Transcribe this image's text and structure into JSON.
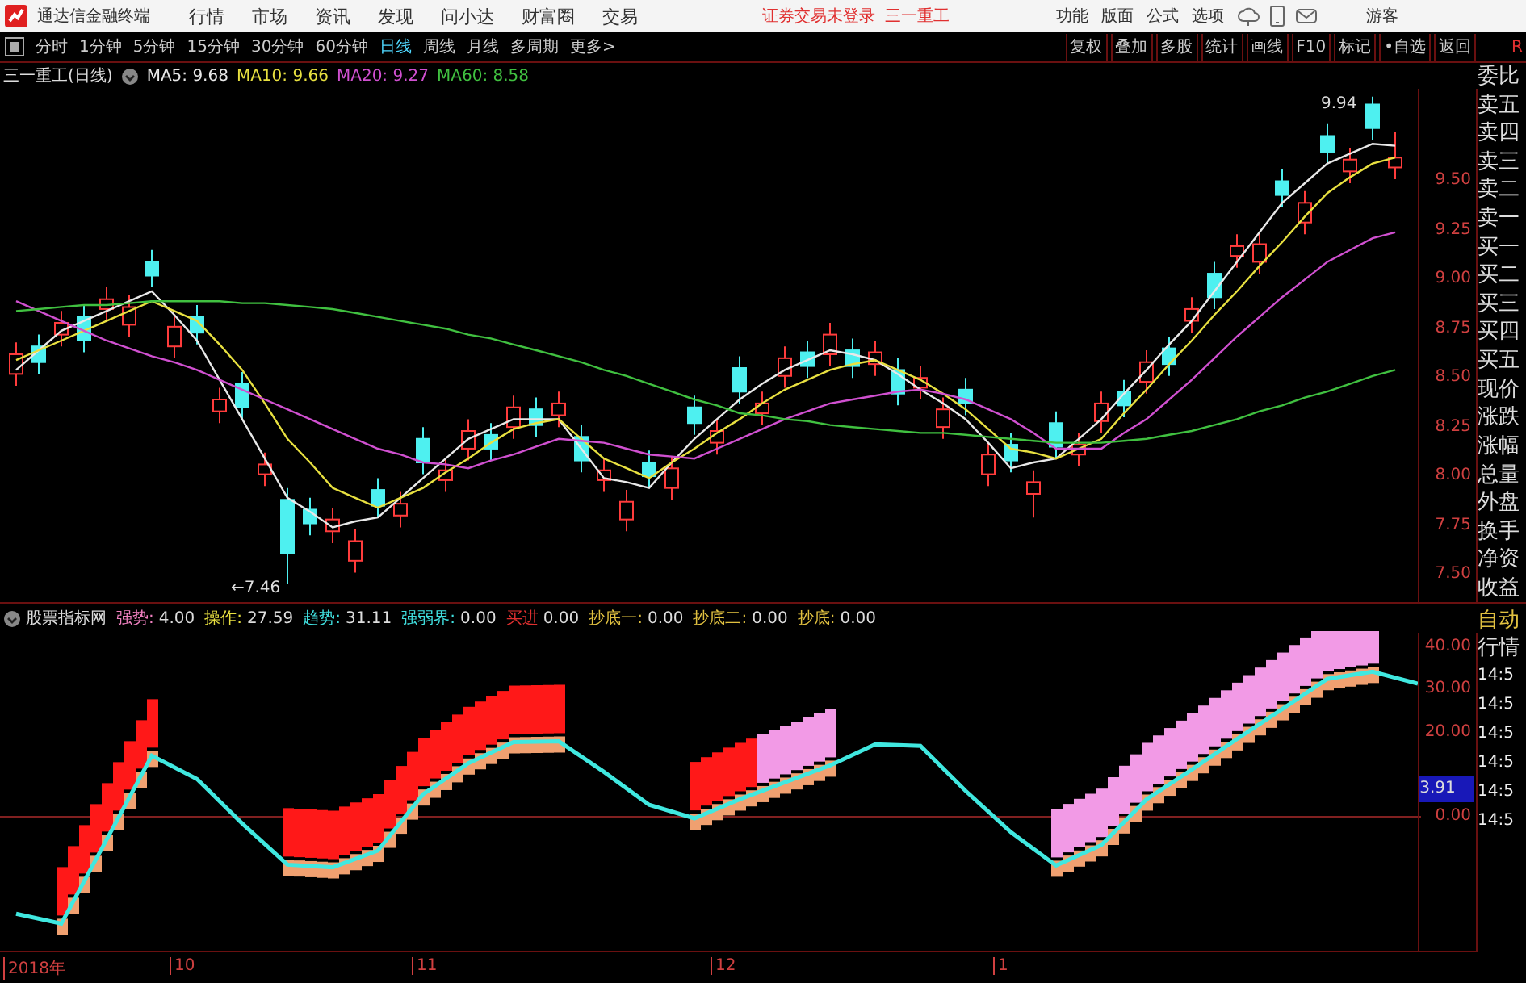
{
  "menu_bar": {
    "app_title": "通达信金融终端",
    "items": [
      "行情",
      "市场",
      "资讯",
      "发现",
      "问小达",
      "财富圈",
      "交易"
    ],
    "status": "证券交易未登录",
    "stock": "三一重工",
    "right_items": [
      "功能",
      "版面",
      "公式",
      "选项"
    ],
    "user": "游客"
  },
  "period_tabs": [
    {
      "label": "分时",
      "selected": false
    },
    {
      "label": "1分钟",
      "selected": false
    },
    {
      "label": "5分钟",
      "selected": false
    },
    {
      "label": "15分钟",
      "selected": false
    },
    {
      "label": "30分钟",
      "selected": false
    },
    {
      "label": "60分钟",
      "selected": false
    },
    {
      "label": "日线",
      "selected": true
    },
    {
      "label": "周线",
      "selected": false
    },
    {
      "label": "月线",
      "selected": false
    },
    {
      "label": "多周期",
      "selected": false
    },
    {
      "label": "更多>",
      "selected": false
    }
  ],
  "tool_buttons": [
    "复权",
    "叠加",
    "多股",
    "统计",
    "画线",
    "F10",
    "标记",
    "•自选",
    "返回"
  ],
  "corner_label": "R",
  "price_chart": {
    "title": "三一重工(日线)",
    "ma": [
      {
        "label": "MA5: 9.68",
        "color": "#e8e8e8"
      },
      {
        "label": "MA10: 9.66",
        "color": "#e8e040"
      },
      {
        "label": "MA20: 9.27",
        "color": "#d050d0"
      },
      {
        "label": "MA60: 8.58",
        "color": "#40c040"
      }
    ],
    "high_label": "9.94",
    "low_label": "←7.46",
    "chart_data": {
      "type": "candlestick",
      "ylim": [
        7.37,
        9.98
      ],
      "yticks": [
        {
          "value": 9.5,
          "label": "9.50"
        },
        {
          "value": 9.25,
          "label": "9.25"
        },
        {
          "value": 9.0,
          "label": "9.00"
        },
        {
          "value": 8.75,
          "label": "8.75"
        },
        {
          "value": 8.5,
          "label": "8.50"
        },
        {
          "value": 8.25,
          "label": "8.25"
        },
        {
          "value": 8.0,
          "label": "8.00"
        },
        {
          "value": 7.75,
          "label": "7.75"
        },
        {
          "value": 7.5,
          "label": "7.50"
        }
      ],
      "ohlc": [
        [
          8.53,
          8.69,
          8.47,
          8.63
        ],
        [
          8.67,
          8.73,
          8.53,
          8.59
        ],
        [
          8.73,
          8.85,
          8.67,
          8.79
        ],
        [
          8.82,
          8.88,
          8.64,
          8.7
        ],
        [
          8.86,
          8.97,
          8.8,
          8.91
        ],
        [
          8.78,
          8.93,
          8.72,
          8.87
        ],
        [
          9.1,
          9.16,
          8.97,
          9.03
        ],
        [
          8.67,
          8.83,
          8.61,
          8.77
        ],
        [
          8.82,
          8.88,
          8.68,
          8.74
        ],
        [
          8.34,
          8.46,
          8.28,
          8.4
        ],
        [
          8.48,
          8.54,
          8.3,
          8.36
        ],
        [
          8.02,
          8.13,
          7.96,
          8.07
        ],
        [
          7.89,
          7.95,
          7.46,
          7.62
        ],
        [
          7.84,
          7.9,
          7.71,
          7.77
        ],
        [
          7.73,
          7.85,
          7.67,
          7.79
        ],
        [
          7.58,
          7.74,
          7.52,
          7.68
        ],
        [
          7.94,
          8.0,
          7.8,
          7.86
        ],
        [
          7.81,
          7.93,
          7.75,
          7.87
        ],
        [
          8.2,
          8.26,
          8.02,
          8.08
        ],
        [
          7.99,
          8.1,
          7.93,
          8.04
        ],
        [
          8.15,
          8.3,
          8.09,
          8.24
        ],
        [
          8.22,
          8.28,
          8.09,
          8.15
        ],
        [
          8.26,
          8.42,
          8.2,
          8.36
        ],
        [
          8.35,
          8.41,
          8.21,
          8.27
        ],
        [
          8.32,
          8.44,
          8.26,
          8.38
        ],
        [
          8.21,
          8.27,
          8.03,
          8.09
        ],
        [
          7.99,
          8.1,
          7.93,
          8.04
        ],
        [
          7.79,
          7.94,
          7.73,
          7.88
        ],
        [
          8.08,
          8.14,
          7.95,
          8.01
        ],
        [
          7.95,
          8.11,
          7.89,
          8.05
        ],
        [
          8.36,
          8.42,
          8.22,
          8.28
        ],
        [
          8.18,
          8.3,
          8.12,
          8.24
        ],
        [
          8.56,
          8.62,
          8.38,
          8.44
        ],
        [
          8.33,
          8.44,
          8.27,
          8.38
        ],
        [
          8.52,
          8.67,
          8.46,
          8.61
        ],
        [
          8.64,
          8.7,
          8.51,
          8.57
        ],
        [
          8.63,
          8.79,
          8.57,
          8.73
        ],
        [
          8.65,
          8.71,
          8.51,
          8.57
        ],
        [
          8.58,
          8.7,
          8.52,
          8.64
        ],
        [
          8.55,
          8.61,
          8.37,
          8.43
        ],
        [
          8.46,
          8.57,
          8.4,
          8.51
        ],
        [
          8.26,
          8.41,
          8.2,
          8.35
        ],
        [
          8.45,
          8.51,
          8.32,
          8.38
        ],
        [
          8.02,
          8.18,
          7.96,
          8.12
        ],
        [
          8.17,
          8.23,
          8.03,
          8.09
        ],
        [
          7.92,
          8.04,
          7.8,
          7.98
        ],
        [
          8.28,
          8.34,
          8.1,
          8.16
        ],
        [
          8.12,
          8.23,
          8.06,
          8.17
        ],
        [
          8.29,
          8.44,
          8.23,
          8.38
        ],
        [
          8.44,
          8.5,
          8.31,
          8.37
        ],
        [
          8.49,
          8.65,
          8.43,
          8.59
        ],
        [
          8.66,
          8.72,
          8.52,
          8.58
        ],
        [
          8.8,
          8.92,
          8.74,
          8.86
        ],
        [
          9.04,
          9.1,
          8.86,
          8.92
        ],
        [
          9.13,
          9.24,
          9.07,
          9.18
        ],
        [
          9.1,
          9.25,
          9.04,
          9.19
        ],
        [
          9.51,
          9.57,
          9.38,
          9.44
        ],
        [
          9.3,
          9.46,
          9.24,
          9.4
        ],
        [
          9.74,
          9.8,
          9.6,
          9.66
        ],
        [
          9.56,
          9.68,
          9.5,
          9.62
        ],
        [
          9.9,
          9.94,
          9.72,
          9.78
        ],
        [
          9.58,
          9.76,
          9.52,
          9.63
        ]
      ],
      "series": [
        {
          "type": "line",
          "color": "#e8e8e8",
          "values": [
            8.55,
            8.65,
            8.75,
            8.8,
            8.85,
            8.9,
            8.95,
            8.83,
            8.7,
            8.5,
            8.3,
            8.1,
            7.9,
            7.83,
            7.75,
            7.78,
            7.8,
            7.9,
            8.0,
            8.1,
            8.2,
            8.25,
            8.3,
            8.3,
            8.3,
            8.15,
            8.0,
            7.98,
            7.95,
            8.08,
            8.2,
            8.3,
            8.4,
            8.48,
            8.55,
            8.6,
            8.65,
            8.63,
            8.6,
            8.53,
            8.45,
            8.38,
            8.3,
            8.18,
            8.05,
            8.08,
            8.1,
            8.2,
            8.3,
            8.43,
            8.55,
            8.68,
            8.8,
            8.95,
            9.1,
            9.25,
            9.4,
            9.5,
            9.6,
            9.65,
            9.7,
            9.69
          ]
        },
        {
          "type": "line",
          "color": "#e8e040",
          "values": [
            8.6,
            8.65,
            8.7,
            8.75,
            8.8,
            8.85,
            8.9,
            8.85,
            8.8,
            8.68,
            8.55,
            8.38,
            8.2,
            8.08,
            7.95,
            7.9,
            7.85,
            7.9,
            7.95,
            8.03,
            8.1,
            8.18,
            8.25,
            8.28,
            8.3,
            8.2,
            8.1,
            8.05,
            8.0,
            8.08,
            8.15,
            8.23,
            8.3,
            8.38,
            8.45,
            8.5,
            8.55,
            8.58,
            8.6,
            8.55,
            8.5,
            8.43,
            8.35,
            8.25,
            8.15,
            8.13,
            8.1,
            8.15,
            8.2,
            8.33,
            8.45,
            8.58,
            8.7,
            8.83,
            8.95,
            9.08,
            9.2,
            9.33,
            9.45,
            9.53,
            9.6,
            9.63
          ]
        },
        {
          "type": "line",
          "color": "#d050d0",
          "values": [
            8.9,
            8.85,
            8.8,
            8.75,
            8.7,
            8.66,
            8.62,
            8.59,
            8.55,
            8.5,
            8.45,
            8.4,
            8.35,
            8.3,
            8.25,
            8.2,
            8.15,
            8.12,
            8.08,
            8.07,
            8.05,
            8.09,
            8.12,
            8.16,
            8.2,
            8.19,
            8.18,
            8.15,
            8.12,
            8.11,
            8.1,
            8.15,
            8.2,
            8.25,
            8.3,
            8.34,
            8.38,
            8.4,
            8.42,
            8.44,
            8.45,
            8.43,
            8.4,
            8.35,
            8.3,
            8.23,
            8.15,
            8.15,
            8.15,
            8.23,
            8.3,
            8.4,
            8.5,
            8.61,
            8.72,
            8.82,
            8.92,
            9.01,
            9.1,
            9.16,
            9.22,
            9.25
          ]
        },
        {
          "type": "line",
          "color": "#40c040",
          "values": [
            8.85,
            8.86,
            8.87,
            8.88,
            8.88,
            8.89,
            8.9,
            8.9,
            8.9,
            8.9,
            8.89,
            8.89,
            8.88,
            8.87,
            8.86,
            8.84,
            8.82,
            8.8,
            8.78,
            8.76,
            8.73,
            8.71,
            8.68,
            8.65,
            8.62,
            8.59,
            8.55,
            8.52,
            8.48,
            8.44,
            8.4,
            8.37,
            8.33,
            8.32,
            8.3,
            8.29,
            8.27,
            8.26,
            8.25,
            8.24,
            8.23,
            8.23,
            8.22,
            8.21,
            8.2,
            8.19,
            8.18,
            8.18,
            8.18,
            8.19,
            8.2,
            8.22,
            8.24,
            8.27,
            8.3,
            8.34,
            8.37,
            8.41,
            8.44,
            8.48,
            8.52,
            8.55
          ]
        }
      ]
    }
  },
  "indicator": {
    "title": "股票指标网",
    "items": [
      {
        "label": "强势:",
        "value": "4.00",
        "color": "#f080c0"
      },
      {
        "label": "操作:",
        "value": "27.59",
        "color": "#e8e040"
      },
      {
        "label": "趋势:",
        "value": "31.11",
        "color": "#40e0e0"
      },
      {
        "label": "强弱界:",
        "value": "0.00",
        "color": "#40e0e0"
      },
      {
        "label": "买进",
        "value": "0.00",
        "color": "#e03030"
      },
      {
        "label": "抄底一:",
        "value": "0.00",
        "color": "#e0c040"
      },
      {
        "label": "抄底二:",
        "value": "0.00",
        "color": "#e0c040"
      },
      {
        "label": "抄底:",
        "value": "0.00",
        "color": "#e0c040"
      }
    ],
    "chart_data": {
      "type": "line",
      "ylim": [
        -31.2,
        43.8
      ],
      "yticks": [
        {
          "value": 40,
          "label": "40.00"
        },
        {
          "value": 30,
          "label": "30.00"
        },
        {
          "value": 20,
          "label": "20.00"
        },
        {
          "value": 0,
          "label": "0.00"
        }
      ],
      "series": [
        {
          "color": "#40e8e0",
          "values": [
            -22.5,
            -24.8,
            -5.0,
            14.8,
            9.3,
            -1.2,
            -10.9,
            -11.5,
            -7.6,
            5.7,
            13.0,
            18.0,
            18.2,
            11.0,
            3.2,
            0.0,
            4.5,
            8.5,
            12.5,
            17.5,
            17.1,
            6.5,
            -3.2,
            -11.1,
            -6.3,
            4.5,
            11.5,
            18.7,
            25.8,
            32.9,
            34.6,
            31.8
          ]
        }
      ]
    },
    "current": "3.91"
  },
  "date_axis": [
    "2018年",
    "10",
    "11",
    "12",
    "1"
  ],
  "quote_panel": [
    "委比",
    "卖五",
    "卖四",
    "卖三",
    "卖二",
    "卖一",
    "买一",
    "买二",
    "买三",
    "买四",
    "买五",
    "现价",
    "涨跌",
    "涨幅",
    "总量",
    "外盘",
    "换手",
    "净资",
    "收益"
  ],
  "tick_panel": {
    "title": "自动",
    "subtitle": "行情",
    "times": [
      "14:5",
      "14:5",
      "14:5",
      "14:5",
      "14:5",
      "14:5"
    ]
  }
}
